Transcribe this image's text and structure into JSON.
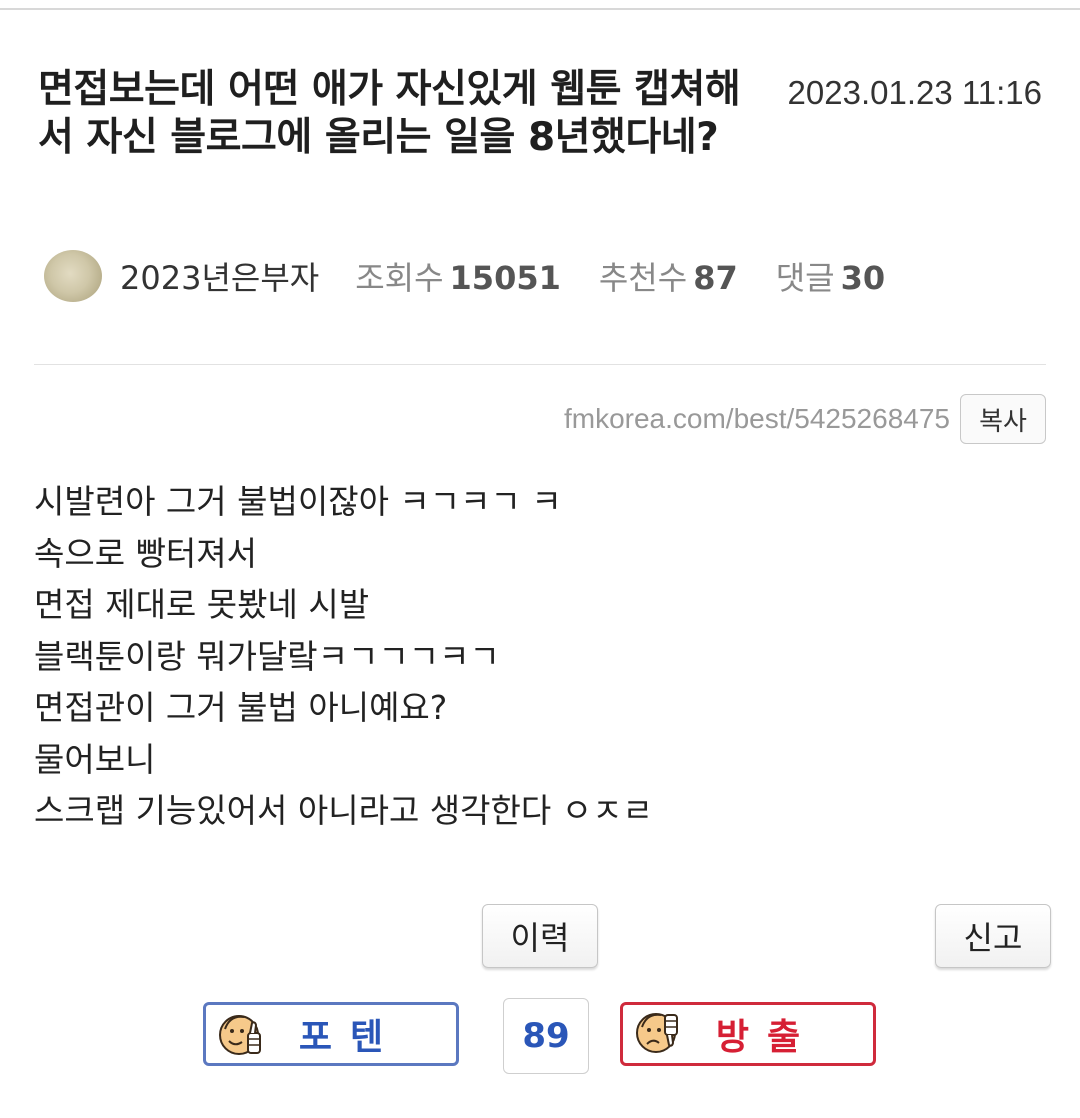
{
  "post": {
    "title": "면접보는데 어떤 애가 자신있게 웹툰 캡쳐해서 자신 블로그에 올리는 일을 8년했다네?",
    "date": "2023.01.23 11:16",
    "author": "2023년은부자",
    "stats": {
      "views_label": "조회수",
      "views": "15051",
      "recommend_label": "추천수",
      "recommend": "87",
      "comments_label": "댓글",
      "comments": "30"
    },
    "url": "fmkorea.com/best/5425268475",
    "copy_label": "복사",
    "body_lines": [
      "시발련아 그거 불법이잖아 ㅋㄱㅋㄱ ㅋ",
      "속으로 빵터져서",
      "면접 제대로 못봤네 시발",
      "블랙툰이랑 뭐가달랔ㅋㄱㄱㄱㅋㄱ",
      "면접관이 그거 불법 아니예요?",
      "물어보니",
      "스크랩 기능있어서 아니라고 생각한다 ㅇㅈㄹ"
    ]
  },
  "actions": {
    "history_label": "이력",
    "report_label": "신고",
    "upvote_label": "포텐",
    "downvote_label": "방출",
    "vote_score": "89"
  },
  "colors": {
    "upvote": "#2a56b8",
    "downvote": "#d61f34",
    "score": "#2a56b8"
  },
  "icons": {
    "upvote": "thumbs-up-face-icon",
    "downvote": "thumbs-down-face-icon"
  }
}
